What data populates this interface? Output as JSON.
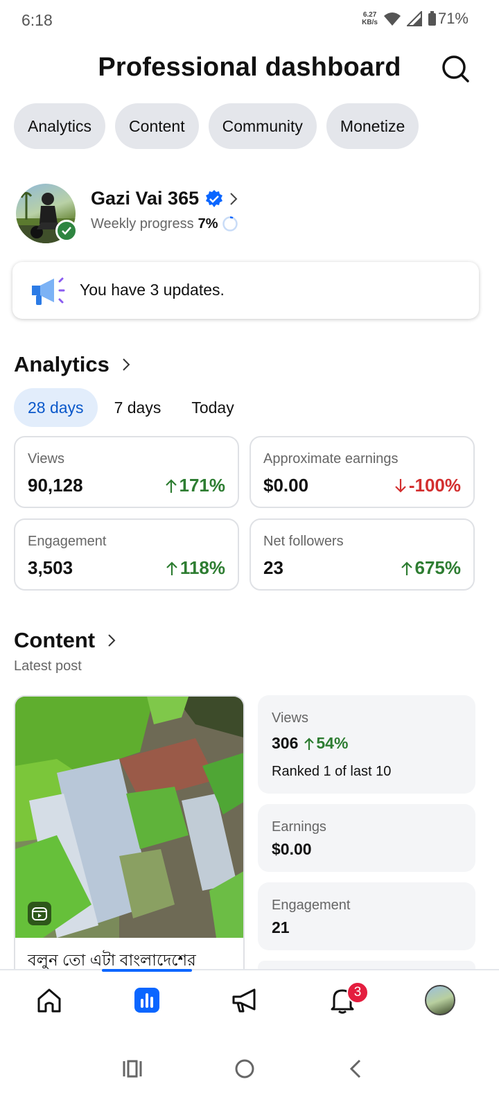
{
  "status_bar": {
    "time": "6:18",
    "net_speed_value": "6.27",
    "net_speed_unit": "KB/s",
    "battery": "71%"
  },
  "header": {
    "title": "Professional dashboard",
    "search_icon": "search-icon"
  },
  "tabs": [
    "Analytics",
    "Content",
    "Community",
    "Monetize"
  ],
  "profile": {
    "name": "Gazi Vai 365",
    "progress_label": "Weekly progress",
    "progress_value": "7%"
  },
  "updates": {
    "text": "You have 3 updates."
  },
  "analytics": {
    "title": "Analytics",
    "ranges": [
      "28 days",
      "7 days",
      "Today"
    ],
    "active_range": "28 days",
    "metrics": [
      {
        "label": "Views",
        "value": "90,128",
        "change": "171%",
        "direction": "up"
      },
      {
        "label": "Approximate earnings",
        "value": "$0.00",
        "change": "-100%",
        "direction": "down"
      },
      {
        "label": "Engagement",
        "value": "3,503",
        "change": "118%",
        "direction": "up"
      },
      {
        "label": "Net followers",
        "value": "23",
        "change": "675%",
        "direction": "up"
      }
    ]
  },
  "content": {
    "title": "Content",
    "subtitle": "Latest post",
    "post_caption": "বলুন তো এটা বাংলাদেশের",
    "stats": {
      "views_label": "Views",
      "views_value": "306",
      "views_change": "54%",
      "views_rank": "Ranked 1 of last 10",
      "earnings_label": "Earnings",
      "earnings_value": "$0.00",
      "engagement_label": "Engagement",
      "engagement_value": "21"
    }
  },
  "bottom_nav": {
    "items": [
      "home-icon",
      "dashboard-icon",
      "megaphone-icon",
      "notifications-icon",
      "profile-avatar"
    ],
    "active": "dashboard-icon",
    "notification_count": "3"
  },
  "colors": {
    "accent_blue": "#0a66ff",
    "positive": "#2e7d32",
    "negative": "#d32f2f",
    "chip_bg": "#e4e6eb"
  }
}
